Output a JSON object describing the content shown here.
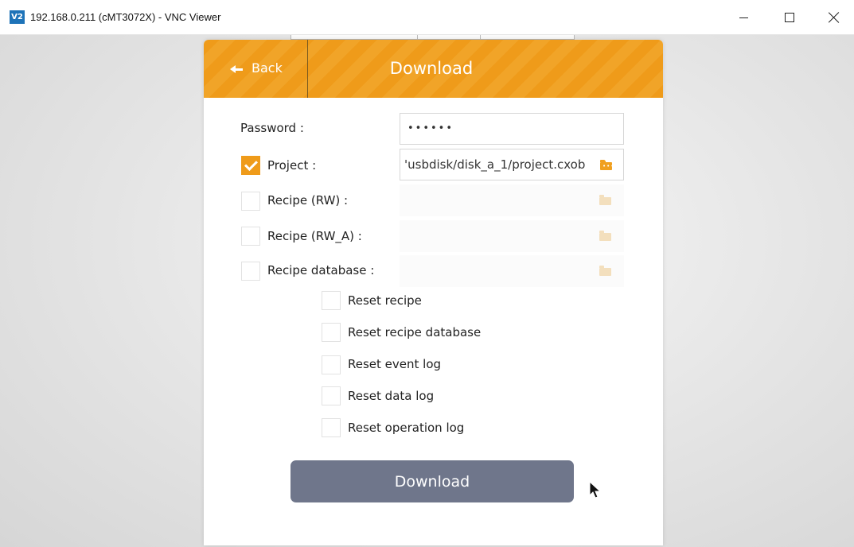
{
  "window": {
    "icon_text": "V2",
    "title": "192.168.0.211 (cMT3072X) - VNC Viewer"
  },
  "dialog": {
    "back_label": "Back",
    "title": "Download",
    "accent_color": "#ef9b1a",
    "password": {
      "label": "Password :",
      "value": "••••••"
    },
    "project": {
      "label": "Project :",
      "checked": true,
      "path": "'usbdisk/disk_a_1/project.cxob",
      "icon": "folder-icon"
    },
    "recipe_rw": {
      "label": "Recipe (RW) :",
      "checked": false,
      "path": "",
      "icon": "folder-icon"
    },
    "recipe_rw_a": {
      "label": "Recipe (RW_A) :",
      "checked": false,
      "path": "",
      "icon": "folder-icon"
    },
    "recipe_database": {
      "label": "Recipe database :",
      "checked": false,
      "path": "",
      "icon": "folder-icon"
    },
    "reset_options": [
      {
        "label": "Reset recipe",
        "checked": false
      },
      {
        "label": "Reset recipe database",
        "checked": false
      },
      {
        "label": "Reset event log",
        "checked": false
      },
      {
        "label": "Reset data log",
        "checked": false
      },
      {
        "label": "Reset operation log",
        "checked": false
      }
    ],
    "download_button": "Download",
    "button_color": "#6f768b"
  }
}
